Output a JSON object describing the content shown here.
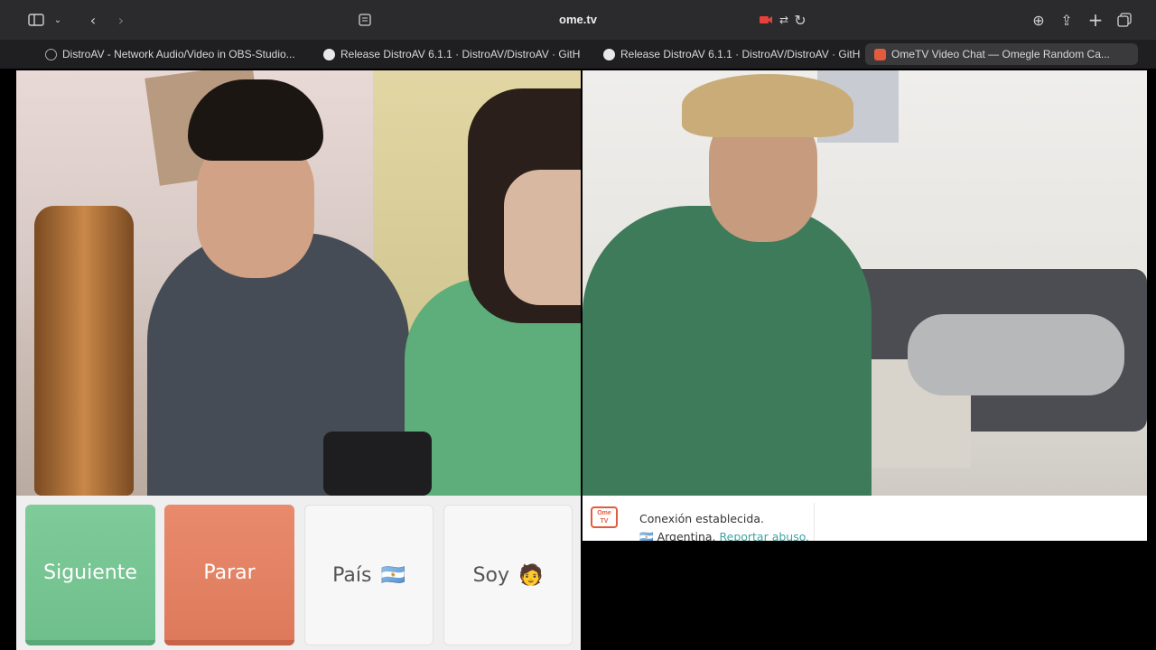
{
  "browser": {
    "url": "ome.tv",
    "tabs": [
      {
        "title": "DistroAV - Network Audio/Video in OBS-Studio..."
      },
      {
        "title": "Release DistroAV 6.1.1 · DistroAV/DistroAV · GitH..."
      },
      {
        "title": "Release DistroAV 6.1.1 · DistroAV/DistroAV · GitH..."
      },
      {
        "title": "OmeTV Video Chat — Omegle Random Ca..."
      }
    ],
    "icons": {
      "sidebar": "sidebar-icon",
      "back": "chevron-left-icon",
      "forward": "chevron-right-icon",
      "reader": "reader-icon",
      "camera": "camera-recording-icon",
      "translate": "translate-icon",
      "reload": "reload-icon",
      "download": "download-icon",
      "share": "share-icon",
      "new_tab": "plus-icon",
      "tab_overview": "tabs-overview-icon"
    }
  },
  "controls": {
    "next_label": "Siguiente",
    "stop_label": "Parar",
    "country_label": "País",
    "country_flag": "🇦🇷",
    "gender_label": "Soy",
    "gender_emoji": "🧑"
  },
  "chat": {
    "logo_text": "Ome TV",
    "status": "Conexión establecida.",
    "country": "Argentina.",
    "report_link": "Reportar abuso."
  },
  "colors": {
    "next": "#6fbf8c",
    "stop": "#de7a5c",
    "link": "#3fa5a0",
    "logo": "#e35b3f"
  }
}
